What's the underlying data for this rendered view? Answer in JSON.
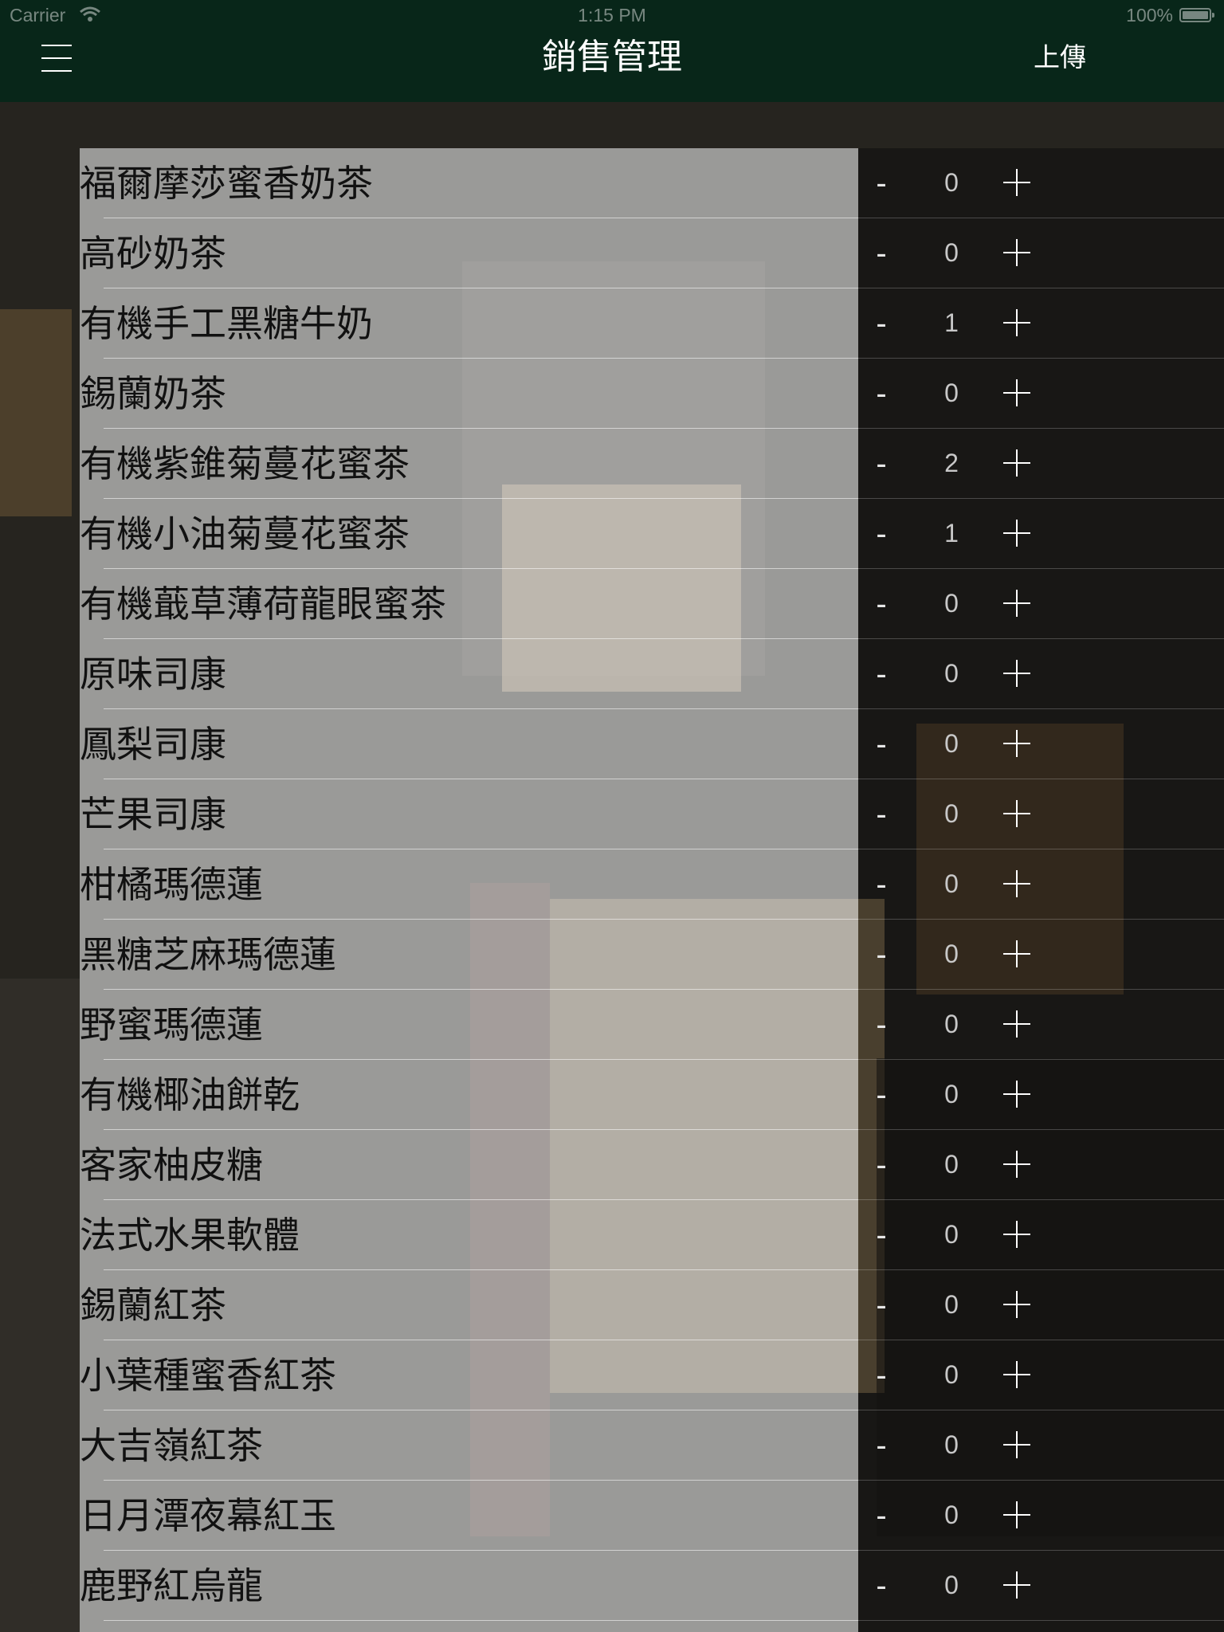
{
  "status_bar": {
    "carrier": "Carrier",
    "time": "1:15 PM",
    "battery": "100%"
  },
  "nav": {
    "title": "銷售管理",
    "upload_label": "上傳",
    "menu_icon": "hamburger-menu-icon"
  },
  "colors": {
    "nav_background": "#082619",
    "list_name_background": "rgba(200,200,200,0.72)",
    "quantity_background": "rgba(8,8,8,0.45)"
  },
  "controls": {
    "minus_label": "-",
    "plus_icon": "plus-icon"
  },
  "products": [
    {
      "name": "福爾摩莎蜜香奶茶",
      "qty": "0"
    },
    {
      "name": "高砂奶茶",
      "qty": "0"
    },
    {
      "name": "有機手工黑糖牛奶",
      "qty": "1"
    },
    {
      "name": "錫蘭奶茶",
      "qty": "0"
    },
    {
      "name": "有機紫錐菊蔓花蜜茶",
      "qty": "2"
    },
    {
      "name": "有機小油菊蔓花蜜茶",
      "qty": "1"
    },
    {
      "name": "有機蕺草薄荷龍眼蜜茶",
      "qty": "0"
    },
    {
      "name": "原味司康",
      "qty": "0"
    },
    {
      "name": "鳳梨司康",
      "qty": "0"
    },
    {
      "name": "芒果司康",
      "qty": "0"
    },
    {
      "name": "柑橘瑪德蓮",
      "qty": "0"
    },
    {
      "name": "黑糖芝麻瑪德蓮",
      "qty": "0"
    },
    {
      "name": "野蜜瑪德蓮",
      "qty": "0"
    },
    {
      "name": "有機椰油餅乾",
      "qty": "0"
    },
    {
      "name": "客家柚皮糖",
      "qty": "0"
    },
    {
      "name": "法式水果軟體",
      "qty": "0"
    },
    {
      "name": "錫蘭紅茶",
      "qty": "0"
    },
    {
      "name": "小葉種蜜香紅茶",
      "qty": "0"
    },
    {
      "name": "大吉嶺紅茶",
      "qty": "0"
    },
    {
      "name": "日月潭夜幕紅玉",
      "qty": "0"
    },
    {
      "name": "鹿野紅烏龍",
      "qty": "0"
    },
    {
      "name": "",
      "qty": ""
    }
  ]
}
